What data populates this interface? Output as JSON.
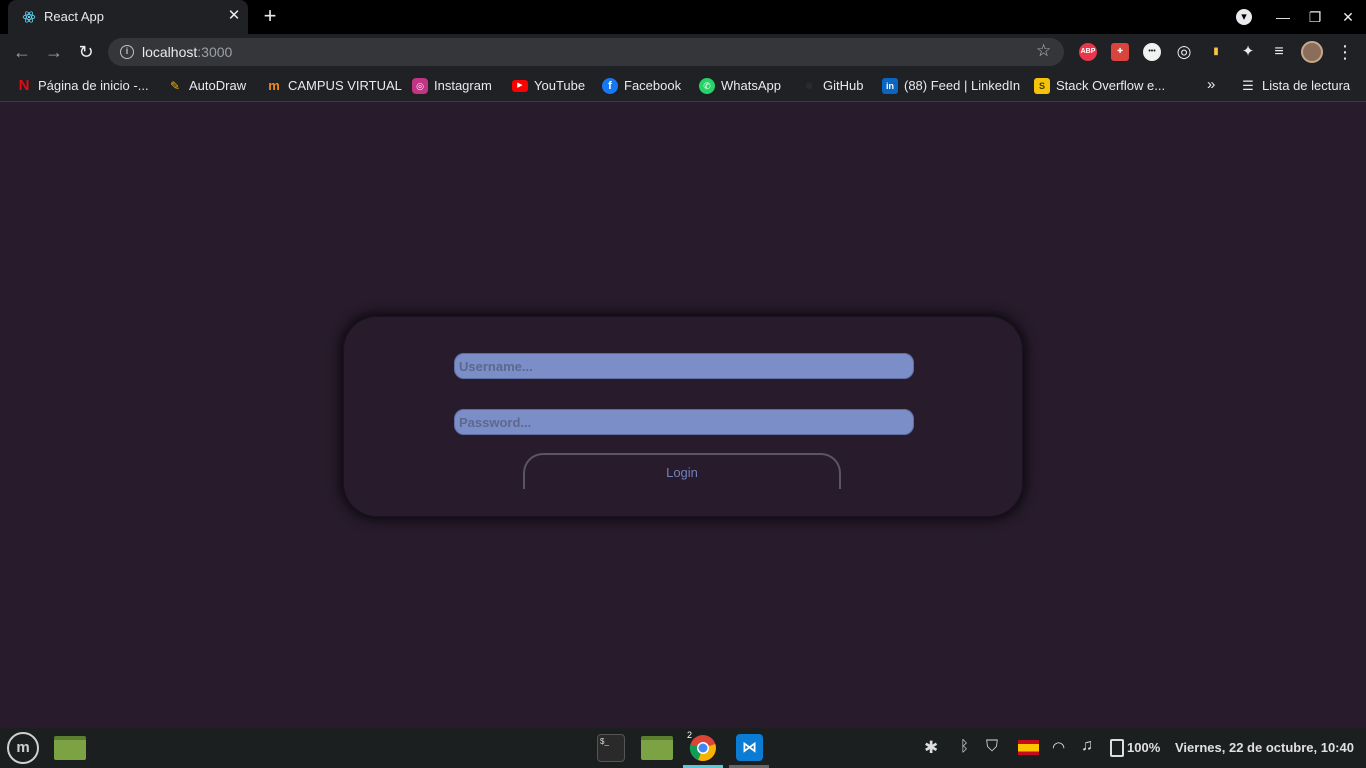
{
  "browser": {
    "tab_title": "React App",
    "tab_close": "✕",
    "new_tab": "+",
    "window_controls": [
      "▾",
      "—",
      "❐",
      "✕"
    ],
    "url_host": "localhost",
    "url_port": ":3000"
  },
  "extensions": [
    {
      "icon": "adblock-icon",
      "label": "ABP",
      "color": "#e8374c"
    },
    {
      "icon": "puzzle-red-icon",
      "label": "✚",
      "color": "#d9443c"
    },
    {
      "icon": "dot-icon",
      "label": "•••",
      "color": "#f1f1f1"
    },
    {
      "icon": "target-icon",
      "label": "◎",
      "color": "#e8eaed"
    },
    {
      "icon": "flag-icon",
      "label": "▮",
      "color": "#f6c343"
    },
    {
      "icon": "extensions-icon",
      "label": "✦",
      "color": "#e8eaed"
    },
    {
      "icon": "reading-queue-icon",
      "label": "≡",
      "color": "#e8eaed"
    }
  ],
  "bookmarks": [
    {
      "icon": "netflix-icon",
      "glyph": "N",
      "color": "#e50914",
      "label": "Página de inicio -..."
    },
    {
      "icon": "autodraw-icon",
      "glyph": "✎",
      "color": "#f4b400",
      "label": "AutoDraw"
    },
    {
      "icon": "campus-icon",
      "glyph": "m",
      "color": "#f08c1e",
      "label": "CAMPUS VIRTUAL"
    },
    {
      "icon": "instagram-icon",
      "glyph": "◎",
      "color": "#c13584",
      "label": "Instagram"
    },
    {
      "icon": "youtube-icon",
      "glyph": "▶",
      "color": "#ff0000",
      "label": "YouTube"
    },
    {
      "icon": "facebook-icon",
      "glyph": "f",
      "color": "#1877f2",
      "label": "Facebook"
    },
    {
      "icon": "whatsapp-icon",
      "glyph": "✆",
      "color": "#25d366",
      "label": "WhatsApp"
    },
    {
      "icon": "github-icon",
      "glyph": "●",
      "color": "#2b2b2b",
      "label": "GitHub"
    },
    {
      "icon": "linkedin-icon",
      "glyph": "in",
      "color": "#0a66c2",
      "label": "(88) Feed | LinkedIn"
    },
    {
      "icon": "stackoverflow-icon",
      "glyph": "S",
      "color": "#f48024",
      "label": "Stack Overflow e..."
    }
  ],
  "bookmarks_more": "»",
  "reading_list": "Lista de lectura",
  "login": {
    "username_placeholder": "Username...",
    "password_placeholder": "Password...",
    "button_label": "Login"
  },
  "taskbar": {
    "chrome_badge": "2",
    "battery": "100%",
    "datetime": "Viernes, 22 de octubre, 10:40"
  }
}
